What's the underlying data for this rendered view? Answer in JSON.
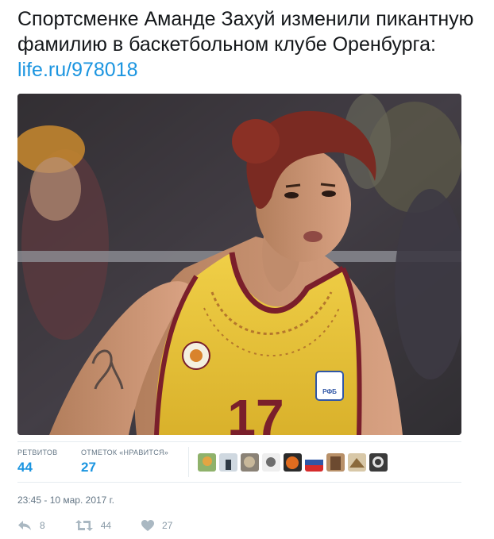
{
  "tweet": {
    "text": "Спортсменке Аманде Захуй изменили пикантную фамилию в баскетбольном клубе Оренбурга: ",
    "link": "life.ru/978018"
  },
  "image": {
    "jersey_number": "17",
    "badge_text": "РФБ",
    "colors": {
      "jersey": "#e8c535",
      "trim": "#7a1f2b",
      "background": "#3b3a40",
      "hair": "#7a2a22"
    }
  },
  "stats": {
    "retweets_label": "РЕТВИТОВ",
    "retweets_value": "44",
    "likes_label": "ОТМЕТОК «НРАВИТСЯ»",
    "likes_value": "27"
  },
  "avatars": [
    "avatar-1",
    "avatar-2",
    "avatar-3",
    "avatar-4",
    "avatar-5",
    "avatar-6",
    "avatar-7",
    "avatar-8",
    "avatar-9"
  ],
  "timestamp": "23:45 - 10 мар. 2017 г.",
  "actions": {
    "reply_count": "8",
    "retweet_count": "44",
    "like_count": "27"
  },
  "icons": {
    "reply": "reply-icon",
    "retweet": "retweet-icon",
    "like": "heart-icon"
  },
  "accent_color": "#1b95e0"
}
